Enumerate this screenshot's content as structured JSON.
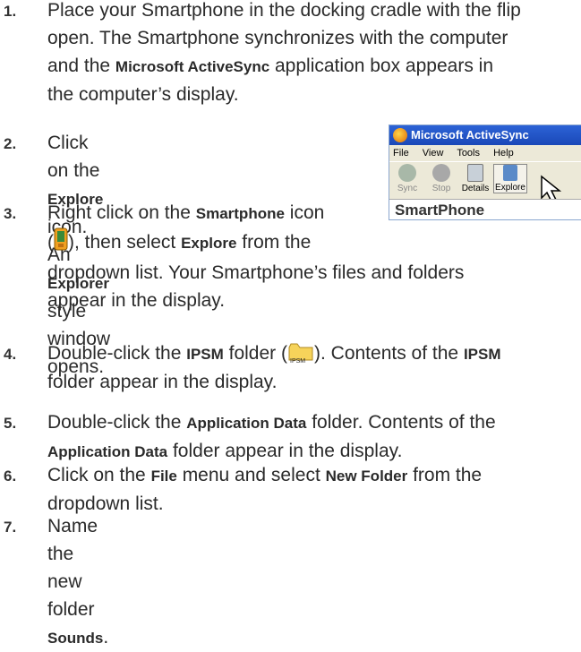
{
  "steps": [
    {
      "num": "1.",
      "parts": [
        {
          "t": "Place your Smartphone in the docking cradle with the flip"
        },
        {
          "t": "open. The Smartphone synchronizes with the computer"
        },
        {
          "t": "and the "
        },
        {
          "b": "Microsoft ActiveSync"
        },
        {
          "t": " application box appears in"
        },
        {
          "t": "the computer’s display."
        }
      ]
    },
    {
      "num": "2.",
      "line1a": "Click on the ",
      "line1b": "Explore",
      "line1c": " icon. An",
      "line2a": "Explorer",
      "line2b": " style window opens."
    },
    {
      "num": "3.",
      "line1a": "Right click on the ",
      "line1b": "Smartphone",
      "line1c": " icon",
      "line2a": "(",
      "line2b": "), then select ",
      "line2c": "Explore",
      "line2d": " from the",
      "line3": "dropdown list. Your Smartphone’s files and folders",
      "line4": "appear in the display."
    },
    {
      "num": "4.",
      "line1a": "Double-click the ",
      "line1b": "IPSM",
      "line1c": " folder (",
      "line1d": "). Contents of the ",
      "line1e": "IPSM",
      "line2": "folder appear in the display.",
      "folder_label": "IPSM"
    },
    {
      "num": "5.",
      "line1a": "Double-click the ",
      "line1b": "Application Data",
      "line1c": " folder. Contents of the",
      "line2a": "Application Data",
      "line2b": " folder appear in the display."
    },
    {
      "num": "6.",
      "line1a": "Click on the ",
      "line1b": "File",
      "line1c": " menu and select ",
      "line1d": "New Folder",
      "line1e": " from the",
      "line2": "dropdown list."
    },
    {
      "num": "7.",
      "line1a": "Name the new folder ",
      "line1b": "Sounds",
      "line1c": "."
    }
  ],
  "activesync": {
    "title": "Microsoft ActiveSync",
    "menu": [
      "File",
      "View",
      "Tools",
      "Help"
    ],
    "toolbar": [
      "Sync",
      "Stop",
      "Details",
      "Explore"
    ],
    "device_bar": "SmartPhone"
  },
  "colors": {
    "title_bar": "#1a48b8",
    "window_bg": "#ece9d8"
  }
}
